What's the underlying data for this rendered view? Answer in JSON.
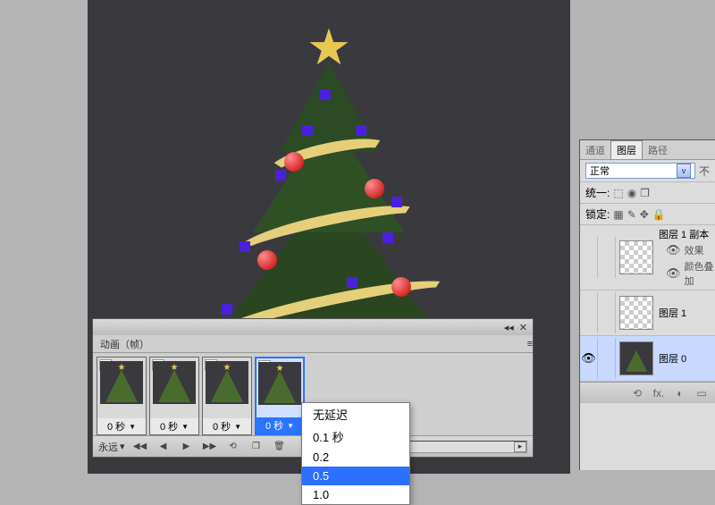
{
  "animation": {
    "tab_label": "动画（帧）",
    "frames": [
      {
        "num": "1",
        "delay": "0 秒"
      },
      {
        "num": "2",
        "delay": "0 秒"
      },
      {
        "num": "3",
        "delay": "0 秒"
      },
      {
        "num": "4",
        "delay": "0 秒"
      }
    ],
    "selected_frame_index": 3,
    "loop_label": "永远",
    "delay_menu": {
      "options": [
        "无延迟",
        "0.1 秒",
        "0.2",
        "0.5",
        "1.0"
      ],
      "selected": "0.5"
    }
  },
  "layers": {
    "tabs": {
      "channels": "通道",
      "layers": "图层",
      "paths": "路径"
    },
    "blend_mode": "正常",
    "unify_label": "统一:",
    "lock_label": "锁定:",
    "items": [
      {
        "name": "图层 1 副本",
        "visible": false,
        "fx_label": "效果",
        "overlay_label": "颜色叠加"
      },
      {
        "name": "图层 1",
        "visible": false
      },
      {
        "name": "图层 0",
        "visible": true,
        "selected": true
      }
    ],
    "footer_fx": "fx."
  }
}
